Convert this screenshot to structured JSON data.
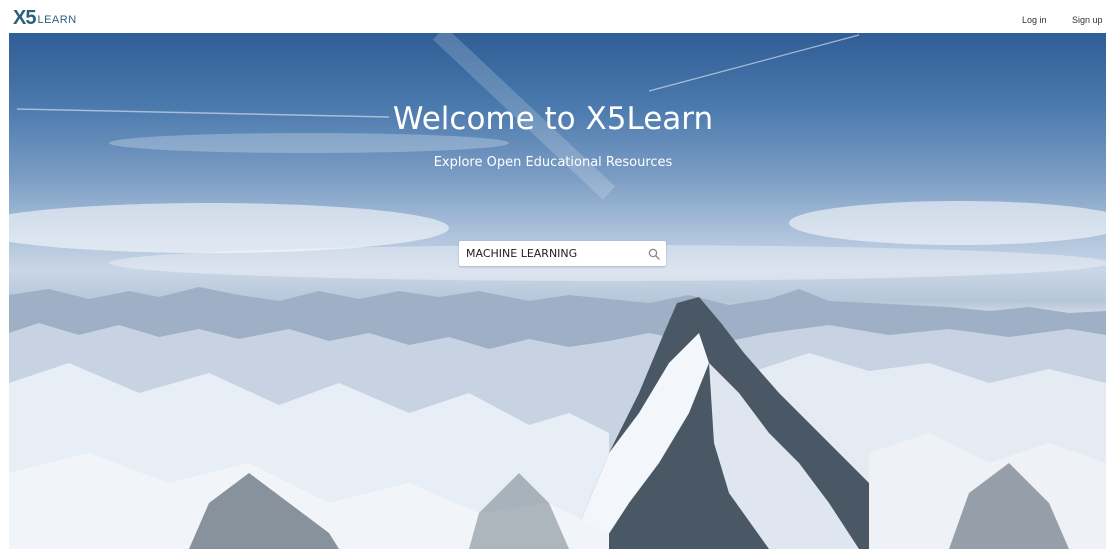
{
  "header": {
    "logo_mark": "X5",
    "logo_text": "LEARN",
    "login_label": "Log in",
    "signup_label": "Sign up"
  },
  "hero": {
    "title": "Welcome to X5Learn",
    "subtitle": "Explore Open Educational Resources"
  },
  "search": {
    "value": "MACHINE LEARNING",
    "icon": "search-icon"
  },
  "colors": {
    "brand": "#2c5f7a",
    "sky_top": "#2f5d95",
    "snow": "#eef2f7",
    "rock": "#3d4a57"
  }
}
